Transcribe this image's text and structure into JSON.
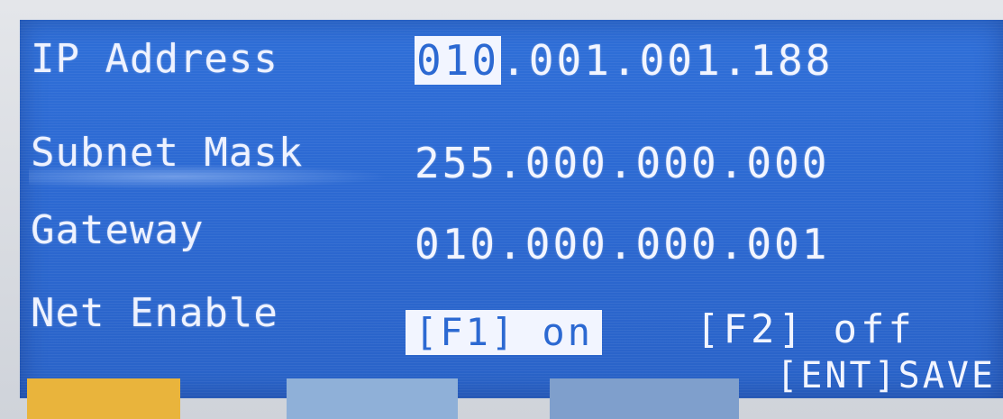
{
  "fields": [
    {
      "label": "IP Address",
      "value_cursor": "010",
      "value_rest": ".001.001.188"
    },
    {
      "label": "Subnet Mask",
      "value": "255.000.000.000"
    },
    {
      "label": "Gateway",
      "value": "010.000.000.001"
    },
    {
      "label": "Net Enable"
    }
  ],
  "net_enable": {
    "on_label": "[F1] on",
    "off_label": "[F2] off"
  },
  "save_label": "[ENT]SAVE",
  "colors": {
    "screen_blue": "#2c69d2",
    "text": "#f2f5ff",
    "softkey_1": "#e9b43c",
    "softkey_2": "#8fb0d8",
    "softkey_3": "#7f9fcc"
  }
}
